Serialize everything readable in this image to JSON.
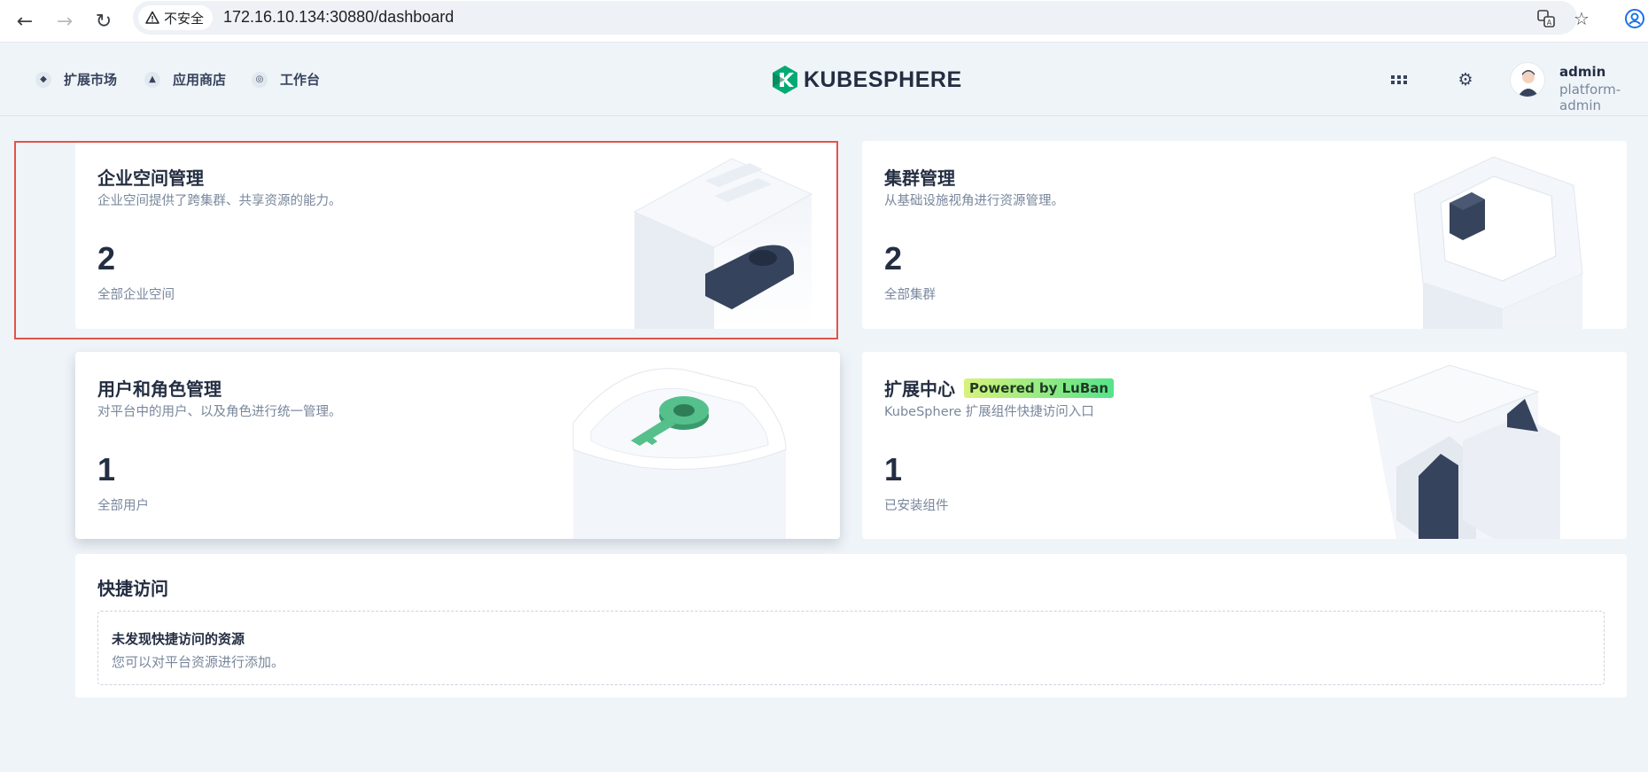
{
  "browser": {
    "security_label": "不安全",
    "url": "172.16.10.134:30880/dashboard"
  },
  "header": {
    "nav": [
      {
        "label": "扩展市场",
        "icon": "extension-market-icon"
      },
      {
        "label": "应用商店",
        "icon": "app-store-icon"
      },
      {
        "label": "工作台",
        "icon": "workbench-icon"
      }
    ],
    "logo_text": "KUBESPHERE",
    "user": {
      "name": "admin",
      "role": "platform-admin"
    }
  },
  "cards": {
    "workspace": {
      "title": "企业空间管理",
      "desc": "企业空间提供了跨集群、共享资源的能力。",
      "count": "2",
      "label": "全部企业空间"
    },
    "cluster": {
      "title": "集群管理",
      "desc": "从基础设施视角进行资源管理。",
      "count": "2",
      "label": "全部集群"
    },
    "users": {
      "title": "用户和角色管理",
      "desc": "对平台中的用户、以及角色进行统一管理。",
      "count": "1",
      "label": "全部用户"
    },
    "extensions": {
      "title": "扩展中心",
      "badge": "Powered by LuBan",
      "desc": "KubeSphere 扩展组件快捷访问入口",
      "count": "1",
      "label": "已安装组件"
    }
  },
  "quick_access": {
    "title": "快捷访问",
    "empty_title": "未发现快捷访问的资源",
    "empty_desc": "您可以对平台资源进行添加。"
  },
  "colors": {
    "accent": "#00aa72",
    "highlight": "#e3534b",
    "background": "#eff4f9"
  }
}
